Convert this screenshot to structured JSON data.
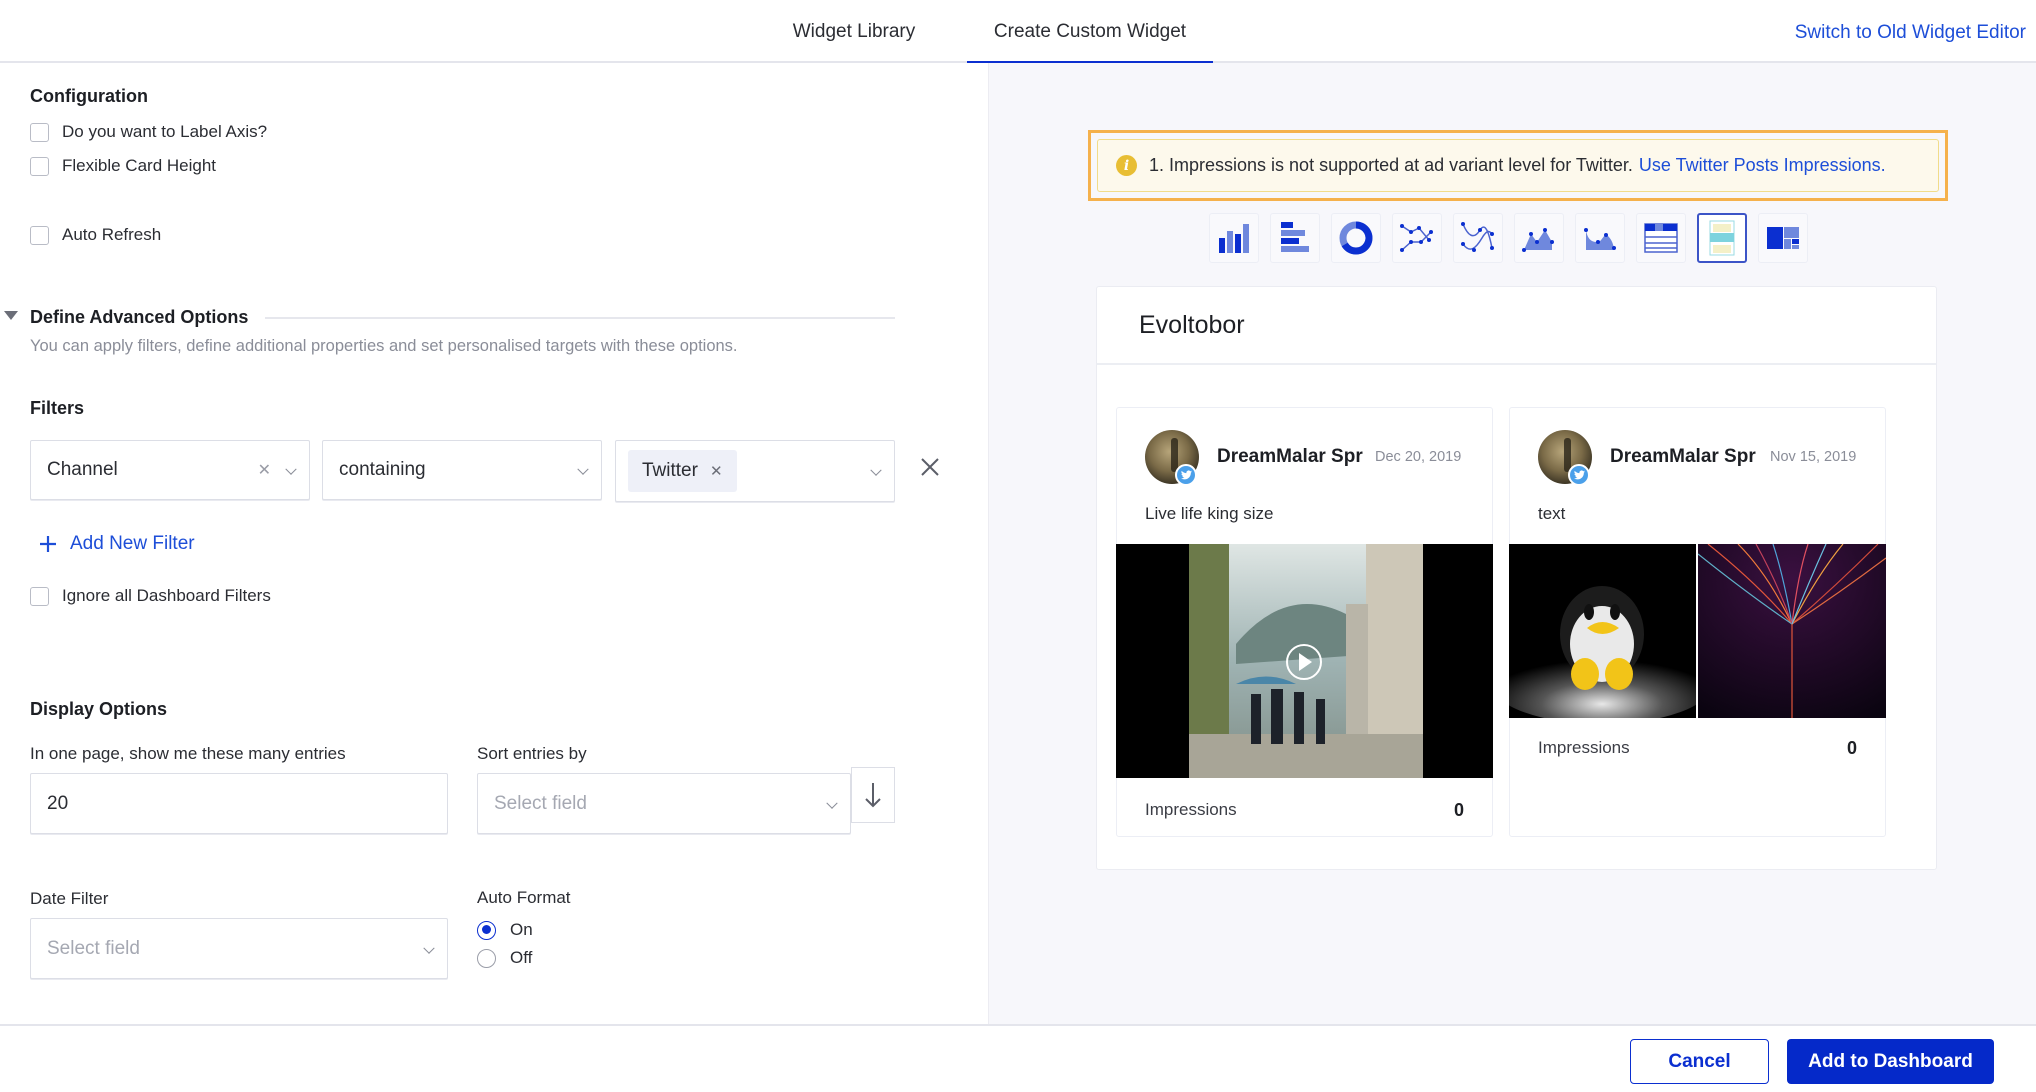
{
  "header": {
    "tabs": [
      {
        "label": "Widget Library",
        "active": false
      },
      {
        "label": "Create Custom Widget",
        "active": true
      }
    ],
    "switch_link": "Switch to Old Widget Editor",
    "accent_color": "#0b2fd0"
  },
  "configuration": {
    "title": "Configuration",
    "options": [
      {
        "label": "Do you want to Label Axis?",
        "checked": false
      },
      {
        "label": "Flexible Card Height",
        "checked": false
      },
      {
        "label": "Auto Refresh",
        "checked": false
      }
    ]
  },
  "advanced": {
    "title": "Define Advanced Options",
    "expanded": true,
    "description": "You can apply filters, define additional properties and set personalised targets with these options."
  },
  "filters": {
    "title": "Filters",
    "rows": [
      {
        "field": "Channel",
        "operator": "containing",
        "values": [
          "Twitter"
        ]
      }
    ],
    "add_label": "Add New Filter",
    "ignore_dashboard": {
      "label": "Ignore all Dashboard Filters",
      "checked": false
    }
  },
  "display": {
    "title": "Display Options",
    "entries_label": "In one page, show me these many entries",
    "entries_value": "20",
    "sort_label": "Sort entries by",
    "sort_placeholder": "Select field",
    "date_label": "Date Filter",
    "date_placeholder": "Select field",
    "auto_format_label": "Auto Format",
    "auto_format_options": [
      {
        "label": "On",
        "selected": true
      },
      {
        "label": "Off",
        "selected": false
      }
    ]
  },
  "footer": {
    "cancel": "Cancel",
    "add": "Add to Dashboard"
  },
  "preview": {
    "warning": {
      "text": "1. Impressions is not supported at ad variant level for Twitter.",
      "link": "Use Twitter Posts Impressions.",
      "highlight_color": "#f5b14c"
    },
    "chart_types": [
      {
        "icon": "column-chart-icon",
        "selected": false
      },
      {
        "icon": "bar-chart-icon",
        "selected": false
      },
      {
        "icon": "donut-chart-icon",
        "selected": false
      },
      {
        "icon": "scatter-line-icon",
        "selected": false
      },
      {
        "icon": "spline-chart-icon",
        "selected": false
      },
      {
        "icon": "area-chart-icon",
        "selected": false
      },
      {
        "icon": "area-spline-icon",
        "selected": false
      },
      {
        "icon": "table-icon",
        "selected": false
      },
      {
        "icon": "post-card-icon",
        "selected": true
      },
      {
        "icon": "treemap-icon",
        "selected": false
      }
    ],
    "widget_title": "Evoltobor",
    "posts": [
      {
        "author": "DreamMalar Spr",
        "date": "Dec 20, 2019",
        "text": "Live life king size",
        "media": "video-street-scene",
        "metric_label": "Impressions",
        "metric_value": "0"
      },
      {
        "author": "DreamMalar Spr",
        "date": "Nov 15, 2019",
        "text": "text",
        "media": "images-penguin-and-fiber",
        "metric_label": "Impressions",
        "metric_value": "0"
      }
    ]
  }
}
